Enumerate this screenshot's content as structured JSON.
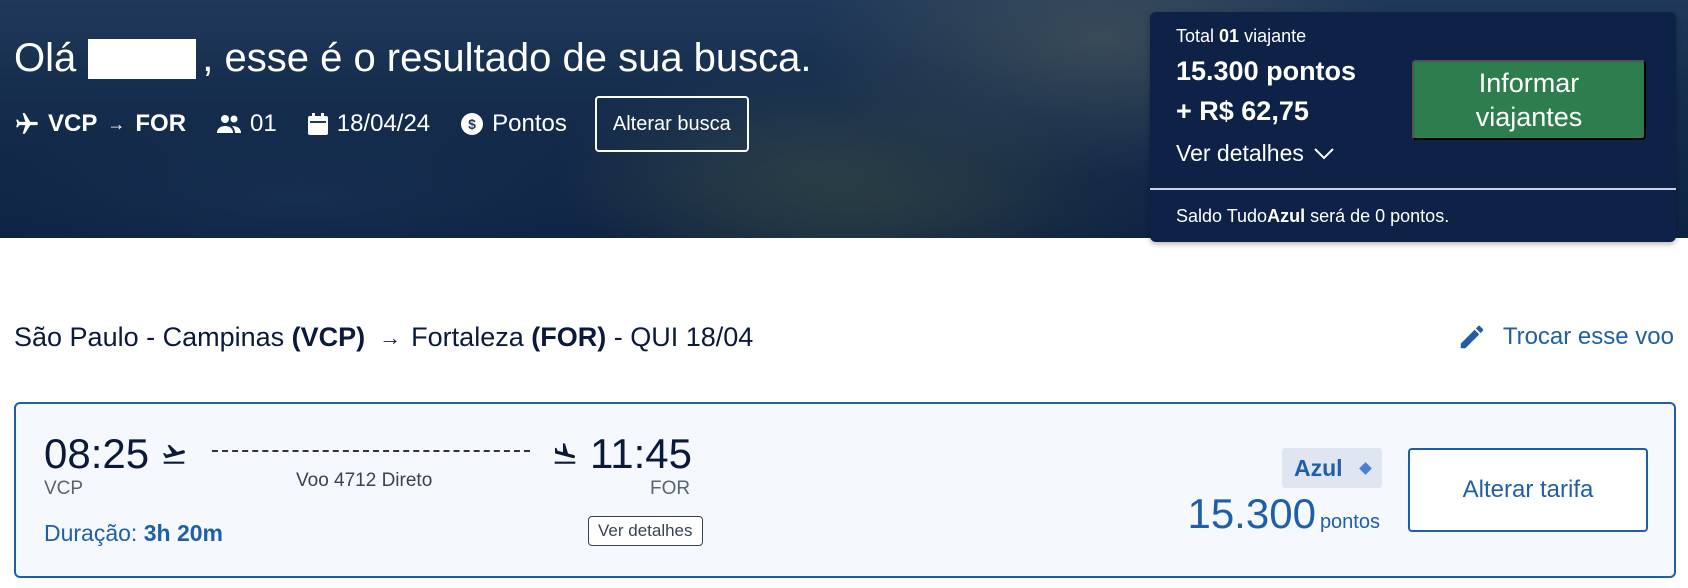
{
  "hero": {
    "greeting_prefix": "Olá",
    "greeting_suffix": ", esse é o resultado de sua busca.",
    "origin": "VCP",
    "arrow": "→",
    "destination": "FOR",
    "passengers": "01",
    "date": "18/04/24",
    "payment": "Pontos",
    "alter_button": "Alterar busca"
  },
  "summary": {
    "total_prefix": "Total",
    "total_count": "01",
    "total_suffix": "viajante",
    "points": "15.300 pontos",
    "money": "+ R$ 62,75",
    "details_label": "Ver detalhes",
    "informar_button": "Informar viajantes",
    "saldo_prefix": "Saldo Tudo",
    "saldo_brand": "Azul",
    "saldo_suffix": "será de 0 pontos."
  },
  "flight_title": {
    "origin_city": "São Paulo - Campinas",
    "origin_code": "(VCP)",
    "arrow": "→",
    "dest_city": "Fortaleza",
    "dest_code": "(FOR)",
    "date_label": "- QUI 18/04",
    "change_label": "Trocar esse voo"
  },
  "flight": {
    "departure_time": "08:25",
    "departure_code": "VCP",
    "arrival_time": "11:45",
    "arrival_code": "FOR",
    "flight_info": "Voo 4712 Direto",
    "duration_label": "Duração:",
    "duration_value": "3h 20m",
    "details_button": "Ver detalhes",
    "fare_name": "Azul",
    "fare_points": "15.300",
    "fare_unit": "pontos",
    "change_fare_button": "Alterar tarifa"
  },
  "colors": {
    "navy": "#0d2246",
    "green": "#2e7d4f",
    "blue": "#1f5fa8"
  }
}
